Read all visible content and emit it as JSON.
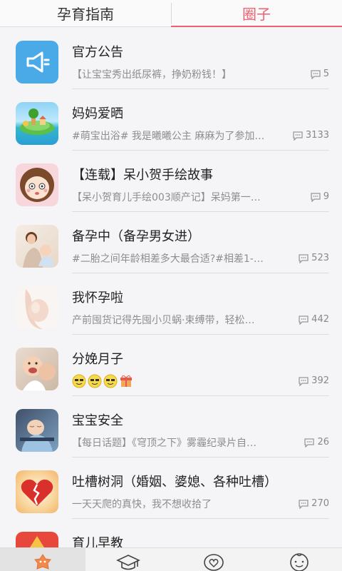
{
  "tabs": [
    {
      "label": "孕育指南"
    },
    {
      "label": "圈子"
    }
  ],
  "items": [
    {
      "title": "官方公告",
      "subtitle": "【让宝宝秀出纸尿裤，挣奶粉钱！】",
      "count": "5"
    },
    {
      "title": "妈妈爱晒",
      "subtitle": "#萌宝出浴# 我是曦曦公主 麻麻为了参加…",
      "count": "3133"
    },
    {
      "title": "【连载】呆小贺手绘故事",
      "subtitle": "【呆小贺育儿手绘003顺产记】呆妈第一…",
      "count": "9"
    },
    {
      "title": "备孕中（备孕男女进）",
      "subtitle": "#二胎之间年龄相差多大最合适?#相差1-…",
      "count": "523"
    },
    {
      "title": "我怀孕啦",
      "subtitle": "产前囤货记得先囤小贝蜗·束缚带，轻松…",
      "count": "442"
    },
    {
      "title": "分娩月子",
      "subtitle": "",
      "count": "392"
    },
    {
      "title": "宝宝安全",
      "subtitle": "【每日话题】《穹顶之下》雾霾纪录片自…",
      "count": "26"
    },
    {
      "title": "吐槽树洞（婚姻、婆媳、各种吐槽）",
      "subtitle": "一天天爬的真快，我不想收拾了",
      "count": "270"
    },
    {
      "title": "育儿早教",
      "subtitle": "",
      "count": ""
    }
  ],
  "icons": {
    "comment": "comment-icon",
    "nav": [
      "home-icon",
      "graduation-cap-icon",
      "heart-chat-icon",
      "baby-face-icon"
    ]
  },
  "colors": {
    "accent": "#ef5f6f",
    "blue": "#4aaae8"
  }
}
